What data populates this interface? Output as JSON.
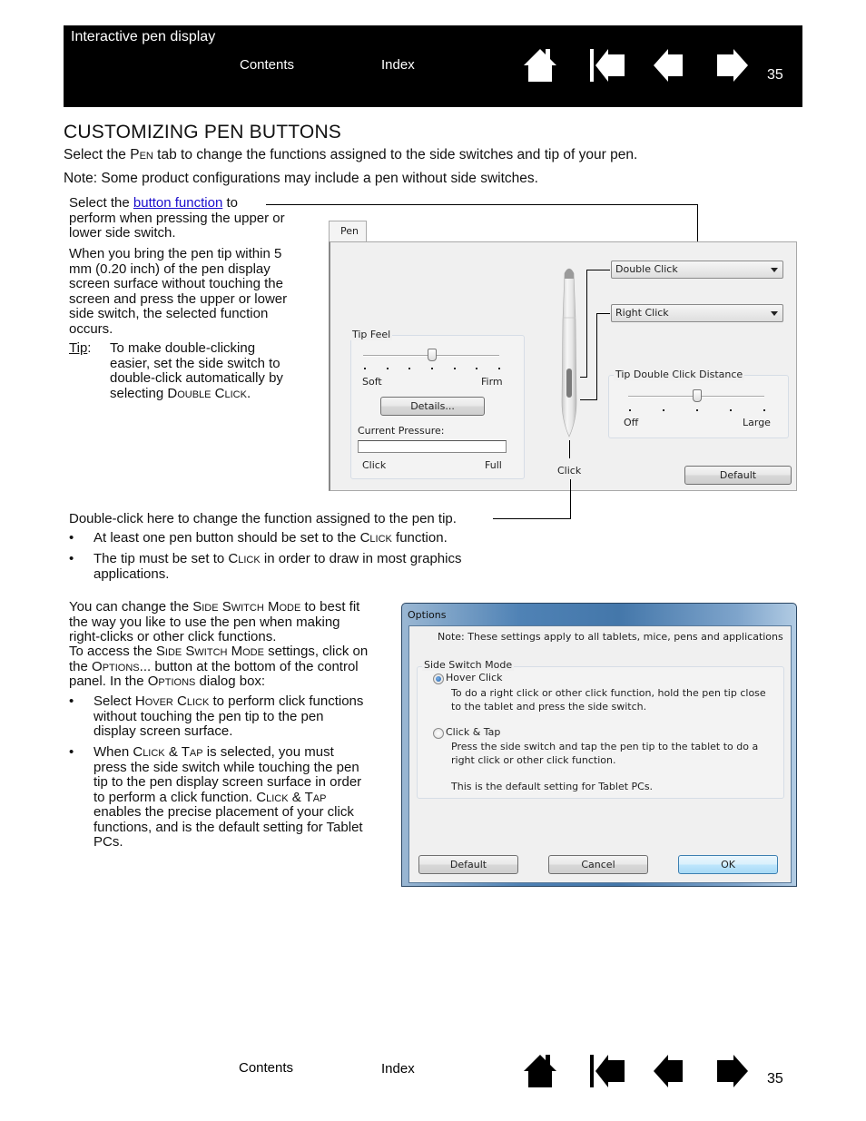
{
  "header": {
    "title": "Interactive pen display",
    "contents_link": "Contents",
    "index_link": "Index",
    "page_number": "35",
    "icons": [
      "home-icon",
      "first-page-icon",
      "previous-page-icon",
      "next-page-icon"
    ]
  },
  "section": {
    "heading": "CUSTOMIZING PEN BUTTONS",
    "intro_pre": "Select the ",
    "intro_sc": "Pen",
    "intro_post": " tab to change the functions assigned to the side switches and tip of your pen.",
    "note": "Note:  Some product configurations may include a pen without side switches."
  },
  "left_callouts": {
    "select_pre": "Select the ",
    "select_link": "button function",
    "select_post": " to perform when pressing the upper or lower side switch.",
    "hover_text": "When you bring the pen tip within 5 mm (0.20 inch) of the pen display screen surface without touching the screen and press the upper or lower side switch, the selected function occurs.",
    "tip_label": "Tip",
    "tip_text_pre": "To make double-clicking easier, set the side switch to double-click automatically by selecting ",
    "tip_text_sc": "Double Click",
    "tip_text_post": "."
  },
  "pen_panel": {
    "tab_label": "Pen",
    "upper_switch_value": "Double Click",
    "lower_switch_value": "Right Click",
    "tip_feel": {
      "title": "Tip Feel",
      "min_label": "Soft",
      "max_label": "Firm",
      "position_fraction": 0.5,
      "tick_count": 7,
      "details_button": "Details...",
      "pressure_label": "Current Pressure:",
      "pressure_fraction": 0,
      "pressure_min_label": "Click",
      "pressure_max_label": "Full"
    },
    "tip_label": "Click",
    "tip_double_click": {
      "title": "Tip Double Click Distance",
      "min_label": "Off",
      "max_label": "Large",
      "position_fraction": 0.5,
      "tick_count": 5
    },
    "default_button": "Default"
  },
  "tip_callout": "Double-click here to change the function assigned to the pen tip.",
  "bullets1": [
    {
      "pre": "At least one pen button should be set to the ",
      "sc": "Click",
      "post": " function."
    },
    {
      "pre": "The tip must be set to ",
      "sc": "Click",
      "post": " in order to draw in most graphics applications."
    }
  ],
  "side_switch_text": {
    "p1_a": "You can change the ",
    "p1_sc": "Side Switch Mode",
    "p1_b": " to best fit the way you like to use the pen when making right-clicks or other click functions.",
    "p2_a": "To access the ",
    "p2_sc1": "Side Switch Mode",
    "p2_b": " settings, click on the ",
    "p2_sc2": "Options",
    "p2_c": "... button at the bottom of the control panel.  In the ",
    "p2_sc3": "Options",
    "p2_d": " dialog box:",
    "b1_a": "Select ",
    "b1_sc": "Hover Click",
    "b1_b": " to perform click functions without touching the pen tip to the pen display screen surface.",
    "b2_a": "When ",
    "b2_sc1": "Click & Tap",
    "b2_b": " is selected, you must press the side switch while touching the pen tip to the pen display screen surface in order to perform a click function.  ",
    "b2_sc2": "Click & Tap",
    "b2_c": " enables the precise placement of your click functions, and is the default setting for Tablet PCs."
  },
  "options_dialog": {
    "title": "Options",
    "note": "Note: These settings apply to all tablets, mice, pens and applications",
    "group_title": "Side Switch Mode",
    "options": [
      {
        "label": "Hover Click",
        "selected": true,
        "desc": "To do a right click or other click function, hold the pen tip close to the tablet and press the side switch."
      },
      {
        "label": "Click & Tap",
        "selected": false,
        "desc": "Press the side switch and tap the pen tip to the tablet to do a right click or other click function.",
        "desc2": "This is the default setting for Tablet PCs."
      }
    ],
    "buttons": {
      "default": "Default",
      "cancel": "Cancel",
      "ok": "OK"
    }
  },
  "footer": {
    "contents_link": "Contents",
    "index_link": "Index",
    "page_number": "35"
  }
}
